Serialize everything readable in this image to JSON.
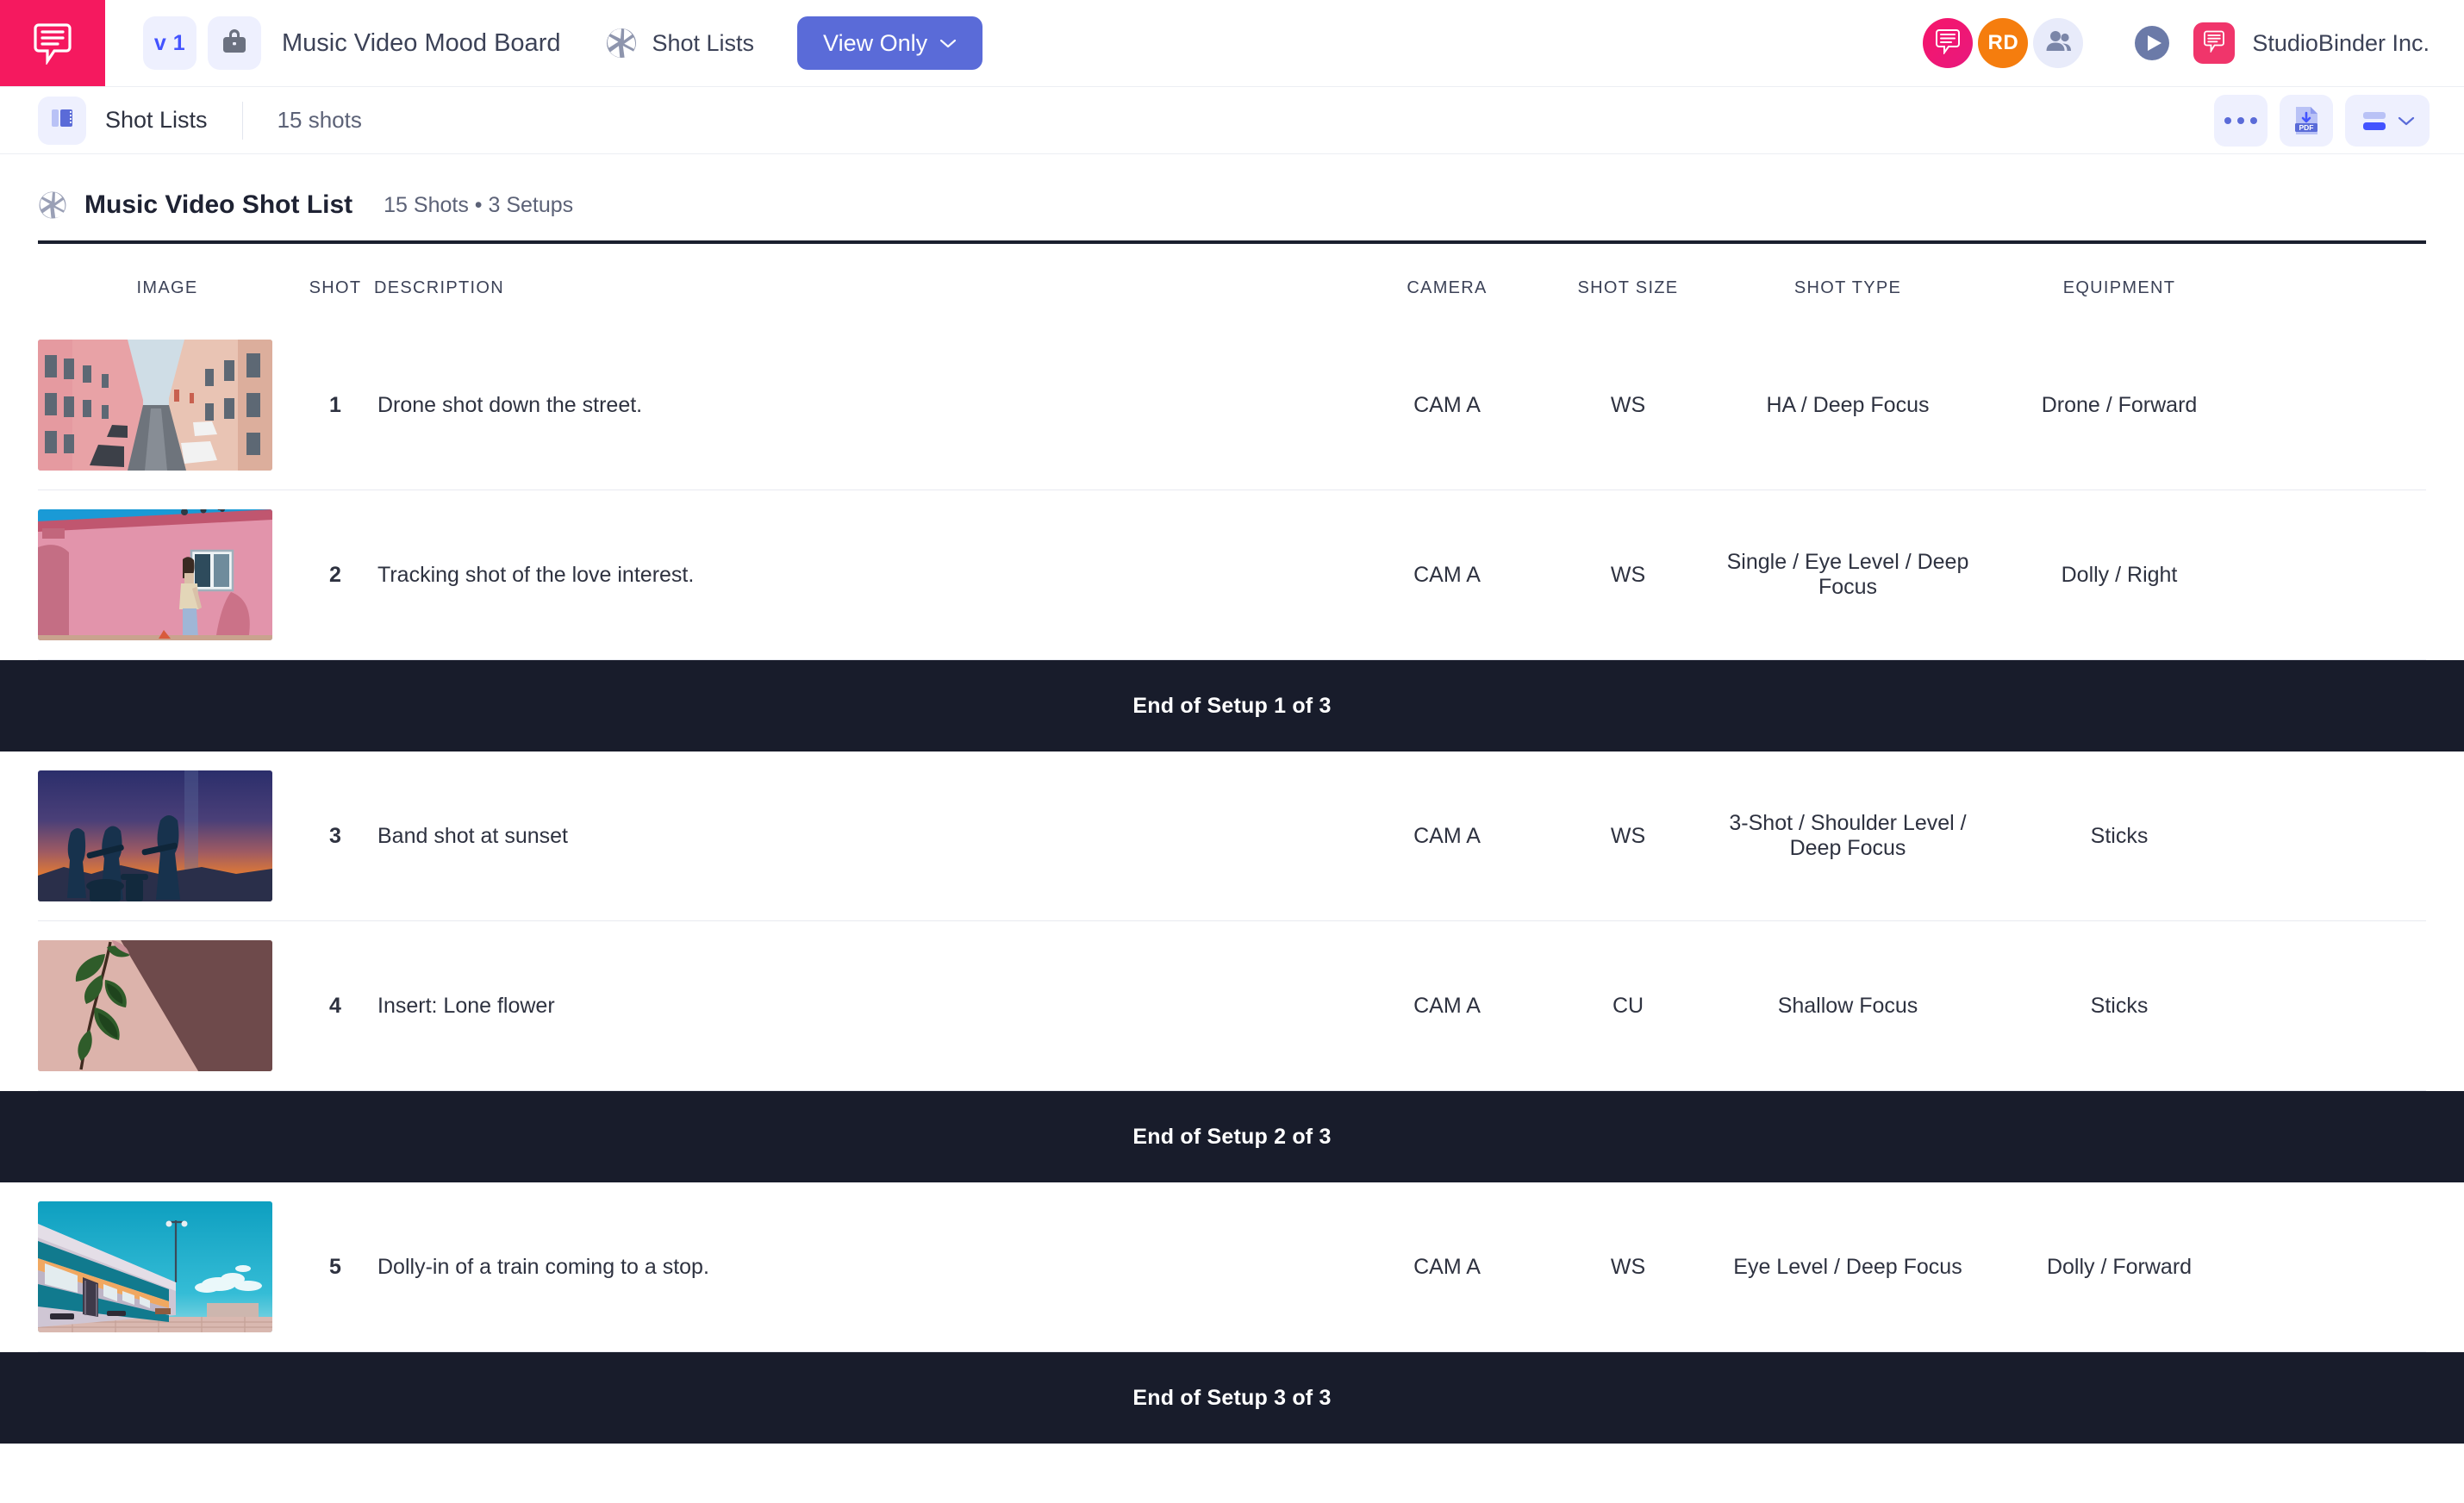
{
  "topbar": {
    "logo_icon": "studiobinder-logo-icon",
    "version_label": "v 1",
    "project_icon": "briefcase-icon",
    "project_title": "Music Video Mood Board",
    "section_icon": "aperture-icon",
    "section_label": "Shot Lists",
    "view_mode_label": "View Only",
    "view_mode_chevron": "chevron-down-icon",
    "notification_icon": "comment-bubble-icon",
    "user_initials": "RD",
    "team_icon": "people-icon",
    "play_icon": "play-circle-icon",
    "brand_icon": "studiobinder-mark-icon",
    "brand_name": "StudioBinder Inc."
  },
  "subbar": {
    "icon": "shot-list-icon",
    "title": "Shot Lists",
    "count": "15 shots",
    "more_icon": "ellipsis-icon",
    "pdf_icon": "pdf-download-icon",
    "layout_icon": "layout-rows-icon",
    "layout_chevron": "chevron-down-icon"
  },
  "list": {
    "icon": "aperture-icon",
    "title": "Music Video Shot List",
    "meta": "15 Shots • 3 Setups"
  },
  "table": {
    "columns": [
      "IMAGE",
      "SHOT",
      "DESCRIPTION",
      "CAMERA",
      "SHOT SIZE",
      "SHOT TYPE",
      "EQUIPMENT"
    ],
    "rows": [
      {
        "kind": "shot",
        "image": "narrow-european-street-with-pink-buildings",
        "shot": "1",
        "description": "Drone shot down the street.",
        "camera": "CAM A",
        "shot_size": "WS",
        "shot_type": "HA / Deep Focus",
        "equipment": "Drone / Forward"
      },
      {
        "kind": "shot",
        "image": "woman-standing-against-pink-wall",
        "shot": "2",
        "description": "Tracking shot of the love interest.",
        "camera": "CAM A",
        "shot_size": "WS",
        "shot_type": "Single / Eye Level / Deep Focus",
        "equipment": "Dolly / Right"
      },
      {
        "kind": "setup",
        "label": "End of  Setup 1 of 3"
      },
      {
        "kind": "shot",
        "image": "band-silhouettes-at-sunset",
        "shot": "3",
        "description": "Band shot at sunset",
        "camera": "CAM A",
        "shot_size": "WS",
        "shot_type": "3-Shot / Shoulder Level / Deep Focus",
        "equipment": "Sticks"
      },
      {
        "kind": "shot",
        "image": "green-plant-stem-on-pink-wall",
        "shot": "4",
        "description": "Insert: Lone flower",
        "camera": "CAM A",
        "shot_size": "CU",
        "shot_type": "Shallow Focus",
        "equipment": "Sticks"
      },
      {
        "kind": "setup",
        "label": "End of  Setup 2 of 3"
      },
      {
        "kind": "shot",
        "image": "teal-train-at-platform",
        "shot": "5",
        "description": "Dolly-in of a train coming to a stop.",
        "camera": "CAM A",
        "shot_size": "WS",
        "shot_type": "Eye Level / Deep Focus",
        "equipment": "Dolly / Forward"
      },
      {
        "kind": "setup",
        "label": "End of  Setup 3 of 3"
      }
    ]
  },
  "colors": {
    "brand_pink": "#f5195f",
    "accent_indigo": "#5a6bd8",
    "chip_bg": "#eef0fe",
    "dark_bar": "#181c2b",
    "avatar_orange": "#f57d0e"
  }
}
